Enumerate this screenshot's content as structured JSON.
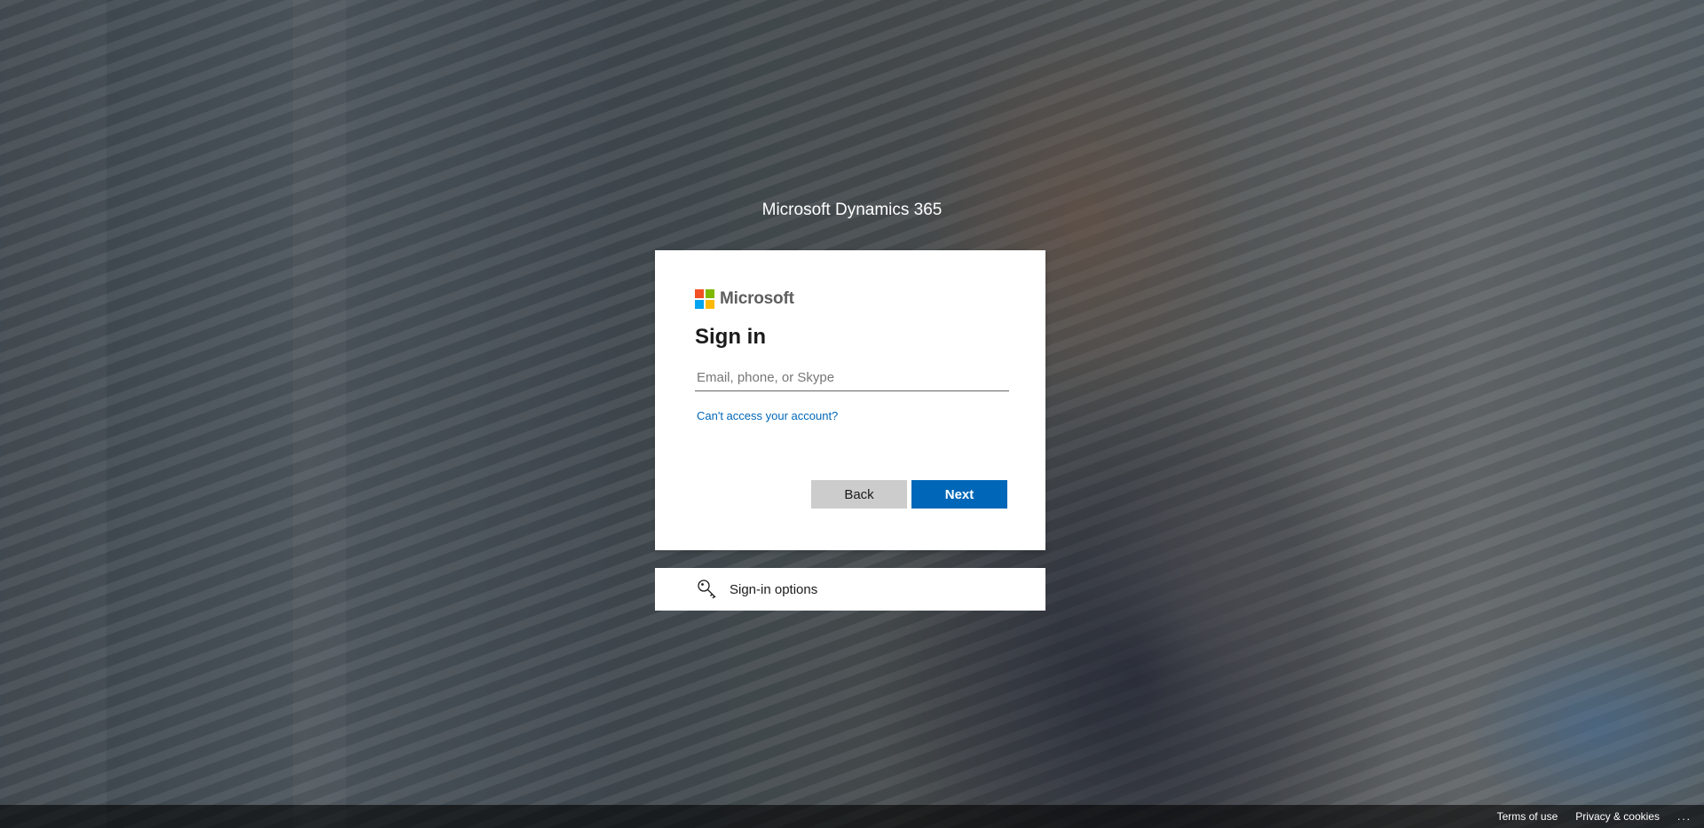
{
  "product_title": "Microsoft Dynamics 365",
  "card": {
    "brand": "Microsoft",
    "brand_colors": [
      "#f25022",
      "#7fba00",
      "#00a4ef",
      "#ffb900"
    ],
    "heading": "Sign in",
    "email_placeholder": "Email, phone, or Skype",
    "email_value": "",
    "cant_access_link": "Can't access your account?",
    "back_button": "Back",
    "next_button": "Next"
  },
  "signin_options": {
    "icon": "key-icon",
    "label": "Sign-in options"
  },
  "footer": {
    "terms": "Terms of use",
    "privacy": "Privacy & cookies",
    "more": "..."
  },
  "colors": {
    "accent": "#0067b8",
    "back_button": "#cccccc"
  }
}
